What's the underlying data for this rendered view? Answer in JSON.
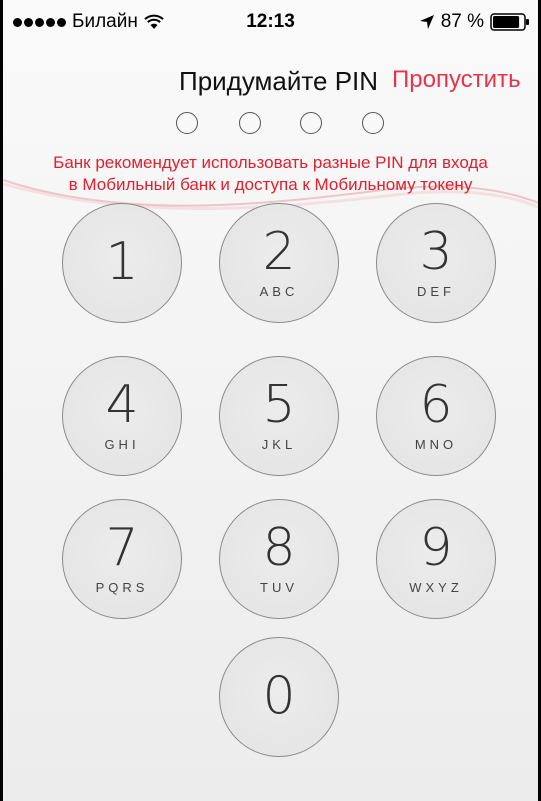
{
  "status_bar": {
    "carrier": "Билайн",
    "time": "12:13",
    "battery_percent": "87 %",
    "battery_level": 0.87
  },
  "header": {
    "title": "Придумайте PIN",
    "skip_label": "Пропустить"
  },
  "pin": {
    "length": 4,
    "entered": 0
  },
  "hint": {
    "line1": "Банк рекомендует использовать разные PIN для входа",
    "line2": "в Мобильный банк и доступа к Мобильному токену"
  },
  "colors": {
    "accent": "#e8334a",
    "hint": "#e0202e"
  },
  "keypad": [
    {
      "digit": "1",
      "letters": ""
    },
    {
      "digit": "2",
      "letters": "ABC"
    },
    {
      "digit": "3",
      "letters": "DEF"
    },
    {
      "digit": "4",
      "letters": "GHI"
    },
    {
      "digit": "5",
      "letters": "JKL"
    },
    {
      "digit": "6",
      "letters": "MNO"
    },
    {
      "digit": "7",
      "letters": "PQRS"
    },
    {
      "digit": "8",
      "letters": "TUV"
    },
    {
      "digit": "9",
      "letters": "WXYZ"
    },
    {
      "digit": "0",
      "letters": ""
    }
  ]
}
